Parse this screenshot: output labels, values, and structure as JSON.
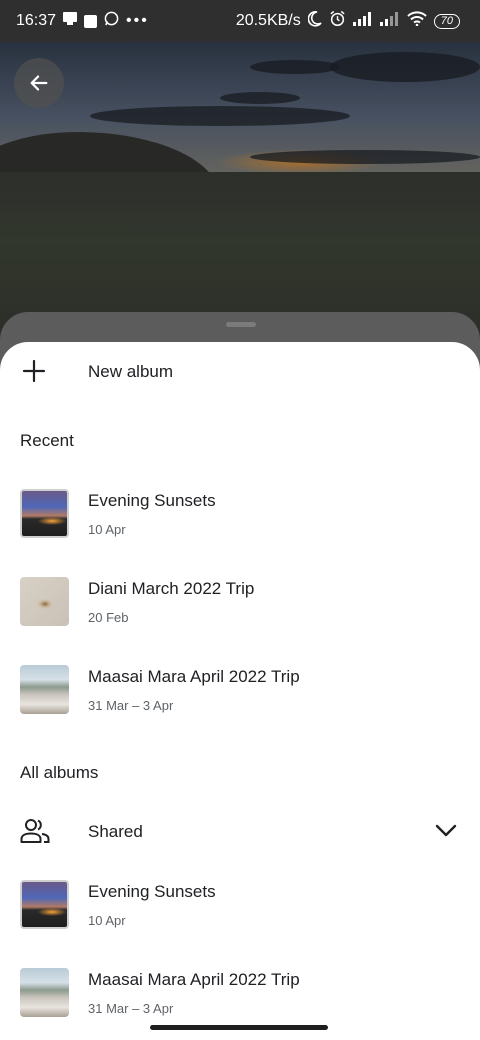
{
  "status_bar": {
    "time": "16:37",
    "network_speed": "20.5KB/s",
    "battery": "70",
    "icons": [
      "screen-record-icon",
      "notification-icon",
      "whatsapp-icon",
      "more-dots-icon",
      "moon-icon",
      "alarm-icon",
      "signal-icon",
      "signal-icon-2",
      "wifi-icon",
      "battery-icon"
    ]
  },
  "header": {
    "back_icon": "arrow-left-icon"
  },
  "sheet": {
    "new_album": {
      "label": "New album",
      "icon": "plus-icon"
    },
    "recent": {
      "heading": "Recent",
      "albums": [
        {
          "title": "Evening Sunsets",
          "date": "10 Apr"
        },
        {
          "title": "Diani March 2022 Trip",
          "date": "20 Feb"
        },
        {
          "title": "Maasai Mara April 2022 Trip",
          "date": "31 Mar – 3 Apr"
        }
      ]
    },
    "all_albums": {
      "heading": "All albums",
      "shared": {
        "label": "Shared",
        "icon": "people-icon",
        "expand_icon": "chevron-down-icon"
      },
      "albums": [
        {
          "title": "Evening Sunsets",
          "date": "10 Apr"
        },
        {
          "title": "Maasai Mara April 2022 Trip",
          "date": "31 Mar – 3 Apr"
        }
      ]
    }
  }
}
